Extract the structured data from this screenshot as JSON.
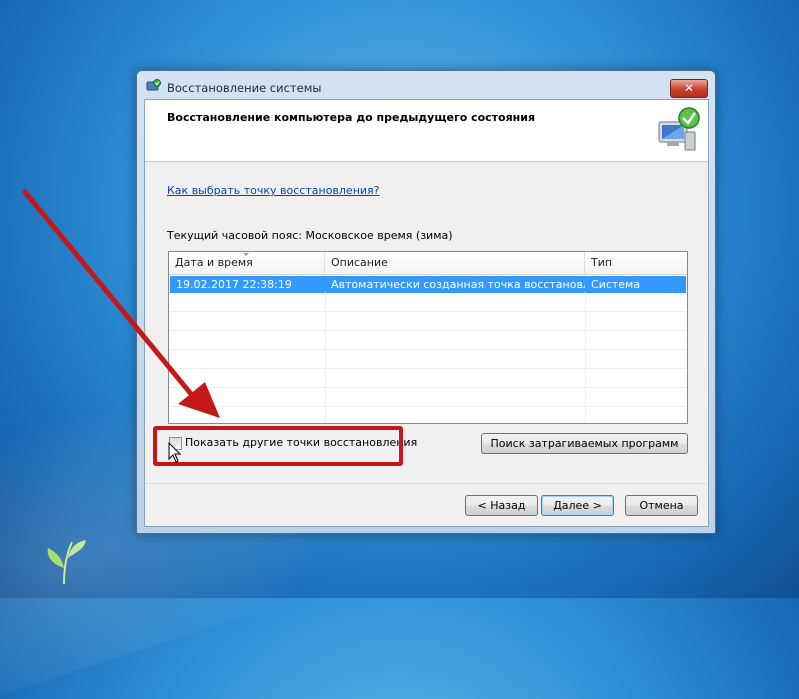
{
  "window": {
    "title": "Восстановление системы",
    "close_label": "✕"
  },
  "header": {
    "title": "Восстановление компьютера до предыдущего состояния",
    "icon": "system-restore-computer-icon"
  },
  "help_link": "Как выбрать точку восстановления?",
  "timezone_text": "Текущий часовой пояс: Московское время (зима)",
  "table": {
    "columns": [
      "Дата и время",
      "Описание",
      "Тип"
    ],
    "rows": [
      {
        "date": "19.02.2017 22:38:19",
        "description": "Автоматически созданная точка восстановле...",
        "type": "Система",
        "selected": true
      }
    ]
  },
  "show_more_label": "Показать другие точки восстановления",
  "show_more_checked": false,
  "buttons": {
    "search": "Поиск затрагиваемых программ",
    "back": "< Назад",
    "next": "Далее >",
    "cancel": "Отмена"
  },
  "colors": {
    "selection": "#3399ff",
    "annotation": "#c41818",
    "link": "#0645ad"
  }
}
